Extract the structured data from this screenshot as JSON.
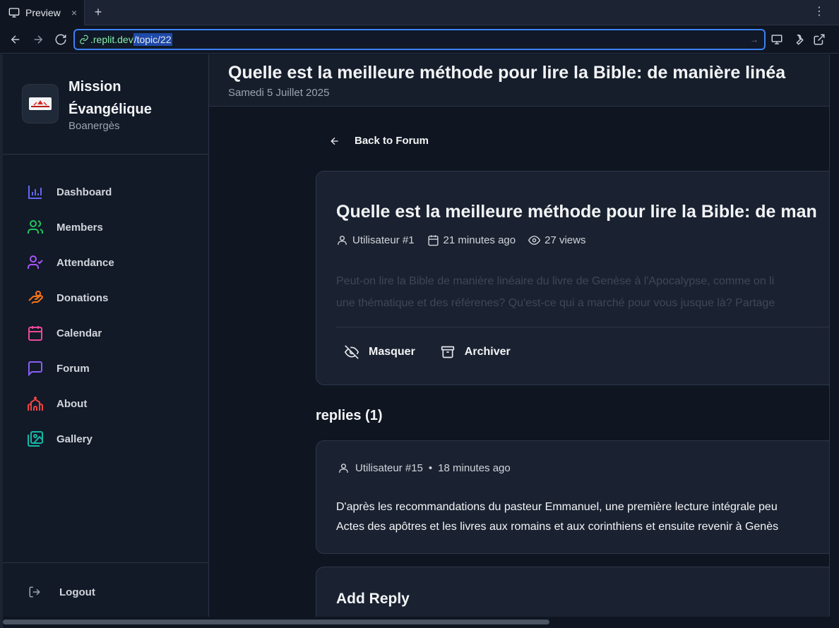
{
  "browser": {
    "tab_title": "Preview",
    "tab_close": "×",
    "new_tab": "+",
    "menu": "⋮",
    "url_host": ".replit.dev",
    "url_path": "/topic/22"
  },
  "brand": {
    "name": "Mission Évangélique",
    "subtitle": "Boanergès"
  },
  "sidebar": {
    "items": [
      {
        "label": "Dashboard",
        "icon": "bar-chart-icon",
        "color": "#6366f1"
      },
      {
        "label": "Members",
        "icon": "users-icon",
        "color": "#22c55e"
      },
      {
        "label": "Attendance",
        "icon": "user-check-icon",
        "color": "#a855f7"
      },
      {
        "label": "Donations",
        "icon": "hand-coins-icon",
        "color": "#f97316"
      },
      {
        "label": "Calendar",
        "icon": "calendar-icon",
        "color": "#ec4899"
      },
      {
        "label": "Forum",
        "icon": "message-icon",
        "color": "#8b5cf6"
      },
      {
        "label": "About",
        "icon": "church-icon",
        "color": "#ef4444"
      },
      {
        "label": "Gallery",
        "icon": "images-icon",
        "color": "#14b8a6"
      }
    ],
    "logout": "Logout"
  },
  "header": {
    "title": "Quelle est la meilleure méthode pour lire la Bible: de manière linéa",
    "date": "Samedi 5 Juillet 2025"
  },
  "main": {
    "back_label": "Back to Forum",
    "topic": {
      "title": "Quelle est la meilleure méthode pour lire la Bible: de man",
      "author": "Utilisateur #1",
      "time": "21 minutes ago",
      "views": "27 views",
      "body_line1": "Peut-on lire la Bible de manière linéaire du livre de Genèse à l'Apocalypse, comme on li",
      "body_line2": "une thématique et des référenes? Qu'est-ce qui a marché pour vous jusque là? Partage",
      "hide_label": "Masquer",
      "archive_label": "Archiver"
    },
    "replies_heading": "replies (1)",
    "reply": {
      "author": "Utilisateur #15",
      "separator": "•",
      "time": "18 minutes ago",
      "body_line1": "D'après les recommandations du pasteur Emmanuel, une première lecture intégrale peu",
      "body_line2": "Actes des apôtres et les livres aux romains et aux corinthiens et ensuite revenir à Genès"
    },
    "add_reply_title": "Add Reply"
  }
}
